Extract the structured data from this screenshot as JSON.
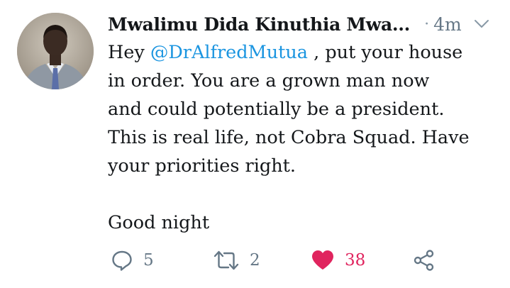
{
  "tweet": {
    "display_name": "Mwalimu Dida Kinuthia Mwa...",
    "separator": "·",
    "timestamp": "4m",
    "body": {
      "line1_pre": "Hey ",
      "mention": "@DrAlfredMutua",
      "line1_post": " , put your house",
      "line2": "in order. You are a grown man now",
      "line3": "and could potentially be a president.",
      "line4": "This is real life, not Cobra Squad. Have",
      "line5": "your priorities right.",
      "line6": "Good night"
    },
    "actions": {
      "reply_count": "5",
      "retweet_count": "2",
      "like_count": "38"
    },
    "icons": {
      "reply": "reply-icon",
      "retweet": "retweet-icon",
      "like": "heart-icon",
      "share": "share-icon",
      "caret": "chevron-down-icon"
    },
    "colors": {
      "mention": "#1b95e0",
      "like": "#e0245e",
      "muted": "#657786",
      "text": "#14171a"
    }
  }
}
